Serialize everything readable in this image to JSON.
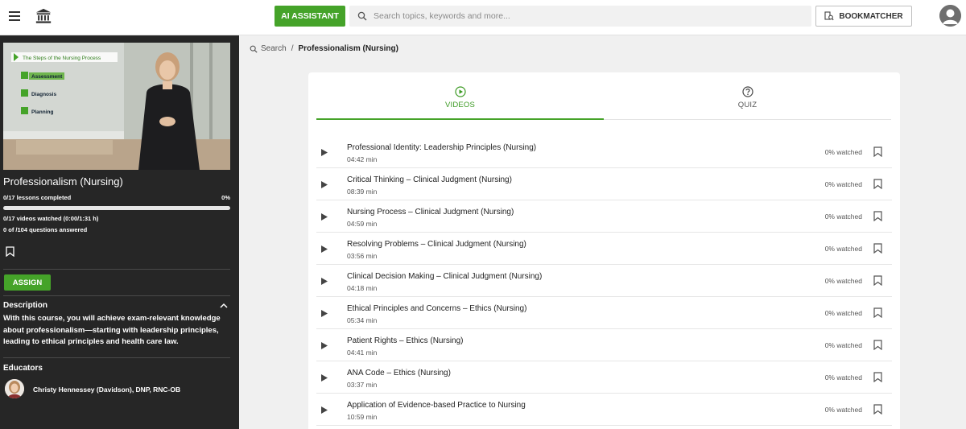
{
  "header": {
    "ai_button": "AI ASSISTANT",
    "search_placeholder": "Search topics, keywords and more...",
    "bookmatcher": "BOOKMATCHER"
  },
  "sidebar": {
    "thumbnail": {
      "slide_title": "The Steps of the Nursing Process",
      "steps": [
        "Assessment",
        "Diagnosis",
        "Planning"
      ]
    },
    "course_title": "Professionalism (Nursing)",
    "lessons_completed": "0/17 lessons completed",
    "progress_percent": "0%",
    "progress_value": 0,
    "videos_watched": "0/17 videos watched (0:00/1:31 h)",
    "questions_answered": "0 of /104 questions answered",
    "assign": "ASSIGN",
    "description_heading": "Description",
    "description_text": "With this course, you will achieve exam-relevant knowledge about professionalism—starting with leadership principles, leading to ethical principles and health care law.",
    "educators_heading": "Educators",
    "educator_name": "Christy Hennessey (Davidson), DNP, RNC-OB"
  },
  "breadcrumb": {
    "search": "Search",
    "separator": "/",
    "current": "Professionalism (Nursing)"
  },
  "tabs": {
    "videos": "VIDEOS",
    "quiz": "QUIZ"
  },
  "videos": [
    {
      "title": "Professional Identity: Leadership Principles (Nursing)",
      "duration": "04:42 min",
      "watched": "0% watched"
    },
    {
      "title": "Critical Thinking – Clinical Judgment (Nursing)",
      "duration": "08:39 min",
      "watched": "0% watched"
    },
    {
      "title": "Nursing Process – Clinical Judgment (Nursing)",
      "duration": "04:59 min",
      "watched": "0% watched"
    },
    {
      "title": "Resolving Problems – Clinical Judgment (Nursing)",
      "duration": "03:56 min",
      "watched": "0% watched"
    },
    {
      "title": "Clinical Decision Making – Clinical Judgment (Nursing)",
      "duration": "04:18 min",
      "watched": "0% watched"
    },
    {
      "title": "Ethical Principles and Concerns – Ethics (Nursing)",
      "duration": "05:34 min",
      "watched": "0% watched"
    },
    {
      "title": "Patient Rights – Ethics (Nursing)",
      "duration": "04:41 min",
      "watched": "0% watched"
    },
    {
      "title": "ANA Code – Ethics (Nursing)",
      "duration": "03:37 min",
      "watched": "0% watched"
    },
    {
      "title": "Application of Evidence-based Practice to Nursing",
      "duration": "10:59 min",
      "watched": "0% watched"
    }
  ],
  "colors": {
    "accent": "#45a329",
    "sidebar_bg": "#262626",
    "page_bg": "#f0f0f0"
  }
}
